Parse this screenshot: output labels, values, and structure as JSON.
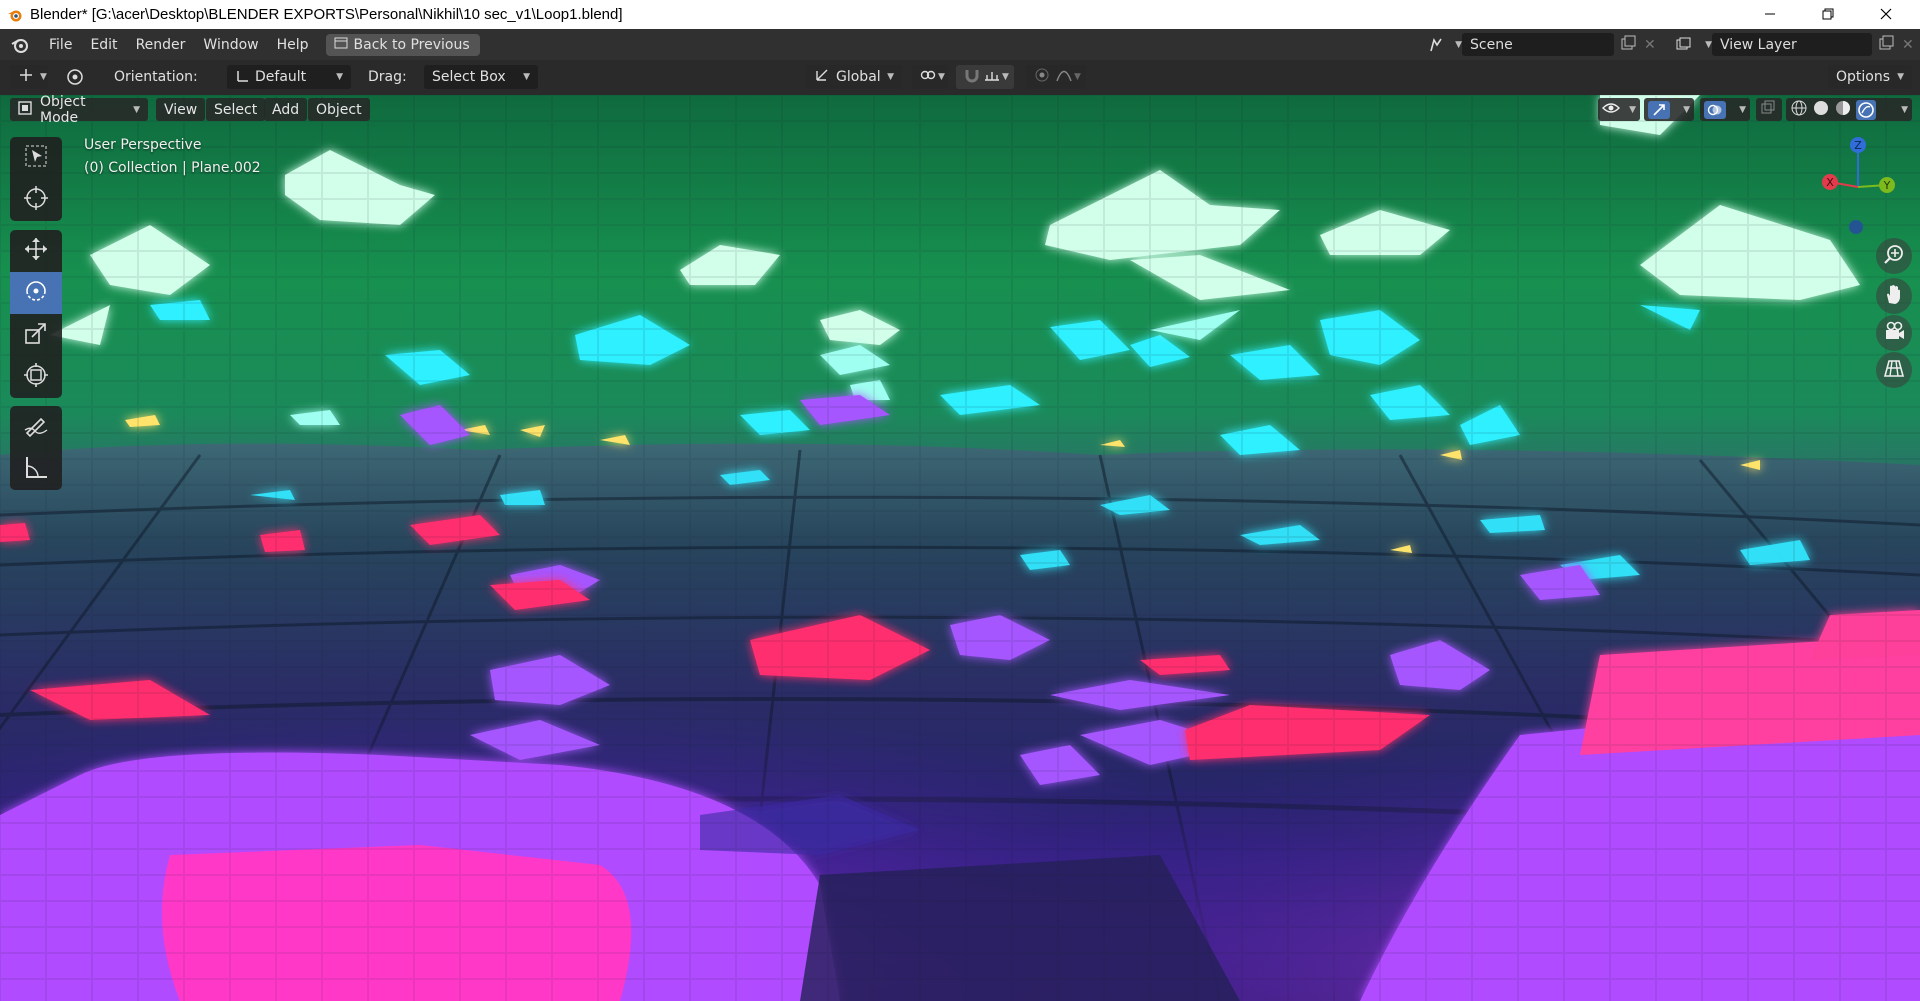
{
  "window": {
    "title": "Blender* [G:\\acer\\Desktop\\BLENDER EXPORTS\\Personal\\Nikhil\\10 sec_v1\\Loop1.blend]",
    "controls": [
      "minimize-icon",
      "restore-icon",
      "close-icon"
    ]
  },
  "menubar": {
    "items": [
      "File",
      "Edit",
      "Render",
      "Window",
      "Help"
    ],
    "back_button": "Back to Previous",
    "scene": "Scene",
    "view_layer": "View Layer"
  },
  "toolheader": {
    "orientation_label": "Orientation:",
    "orientation_value": "Default",
    "drag_label": "Drag:",
    "drag_value": "Select Box",
    "transform_space": "Global",
    "options": "Options"
  },
  "viewport": {
    "mode": "Object Mode",
    "menus": [
      "View",
      "Select",
      "Add",
      "Object"
    ],
    "info_line1": "User Perspective",
    "info_line2": "(0) Collection | Plane.002",
    "gizmo_axes": {
      "x": "X",
      "y": "Y",
      "z": "Z"
    },
    "shading_modes": [
      "wireframe",
      "solid",
      "material-preview",
      "rendered"
    ],
    "active_shading": "rendered"
  },
  "toolbar": {
    "tools": [
      "select-box",
      "cursor",
      "move",
      "rotate",
      "scale",
      "transform",
      "annotate",
      "measure"
    ],
    "active_tool": "rotate"
  },
  "colors": {
    "accent": "#4772b3",
    "glow_green": "#c8ffe6",
    "glow_cyan": "#28f0ff",
    "glow_purple": "#a050ff",
    "glow_pink": "#ff2d7a",
    "glow_yellow": "#ffe36a"
  }
}
